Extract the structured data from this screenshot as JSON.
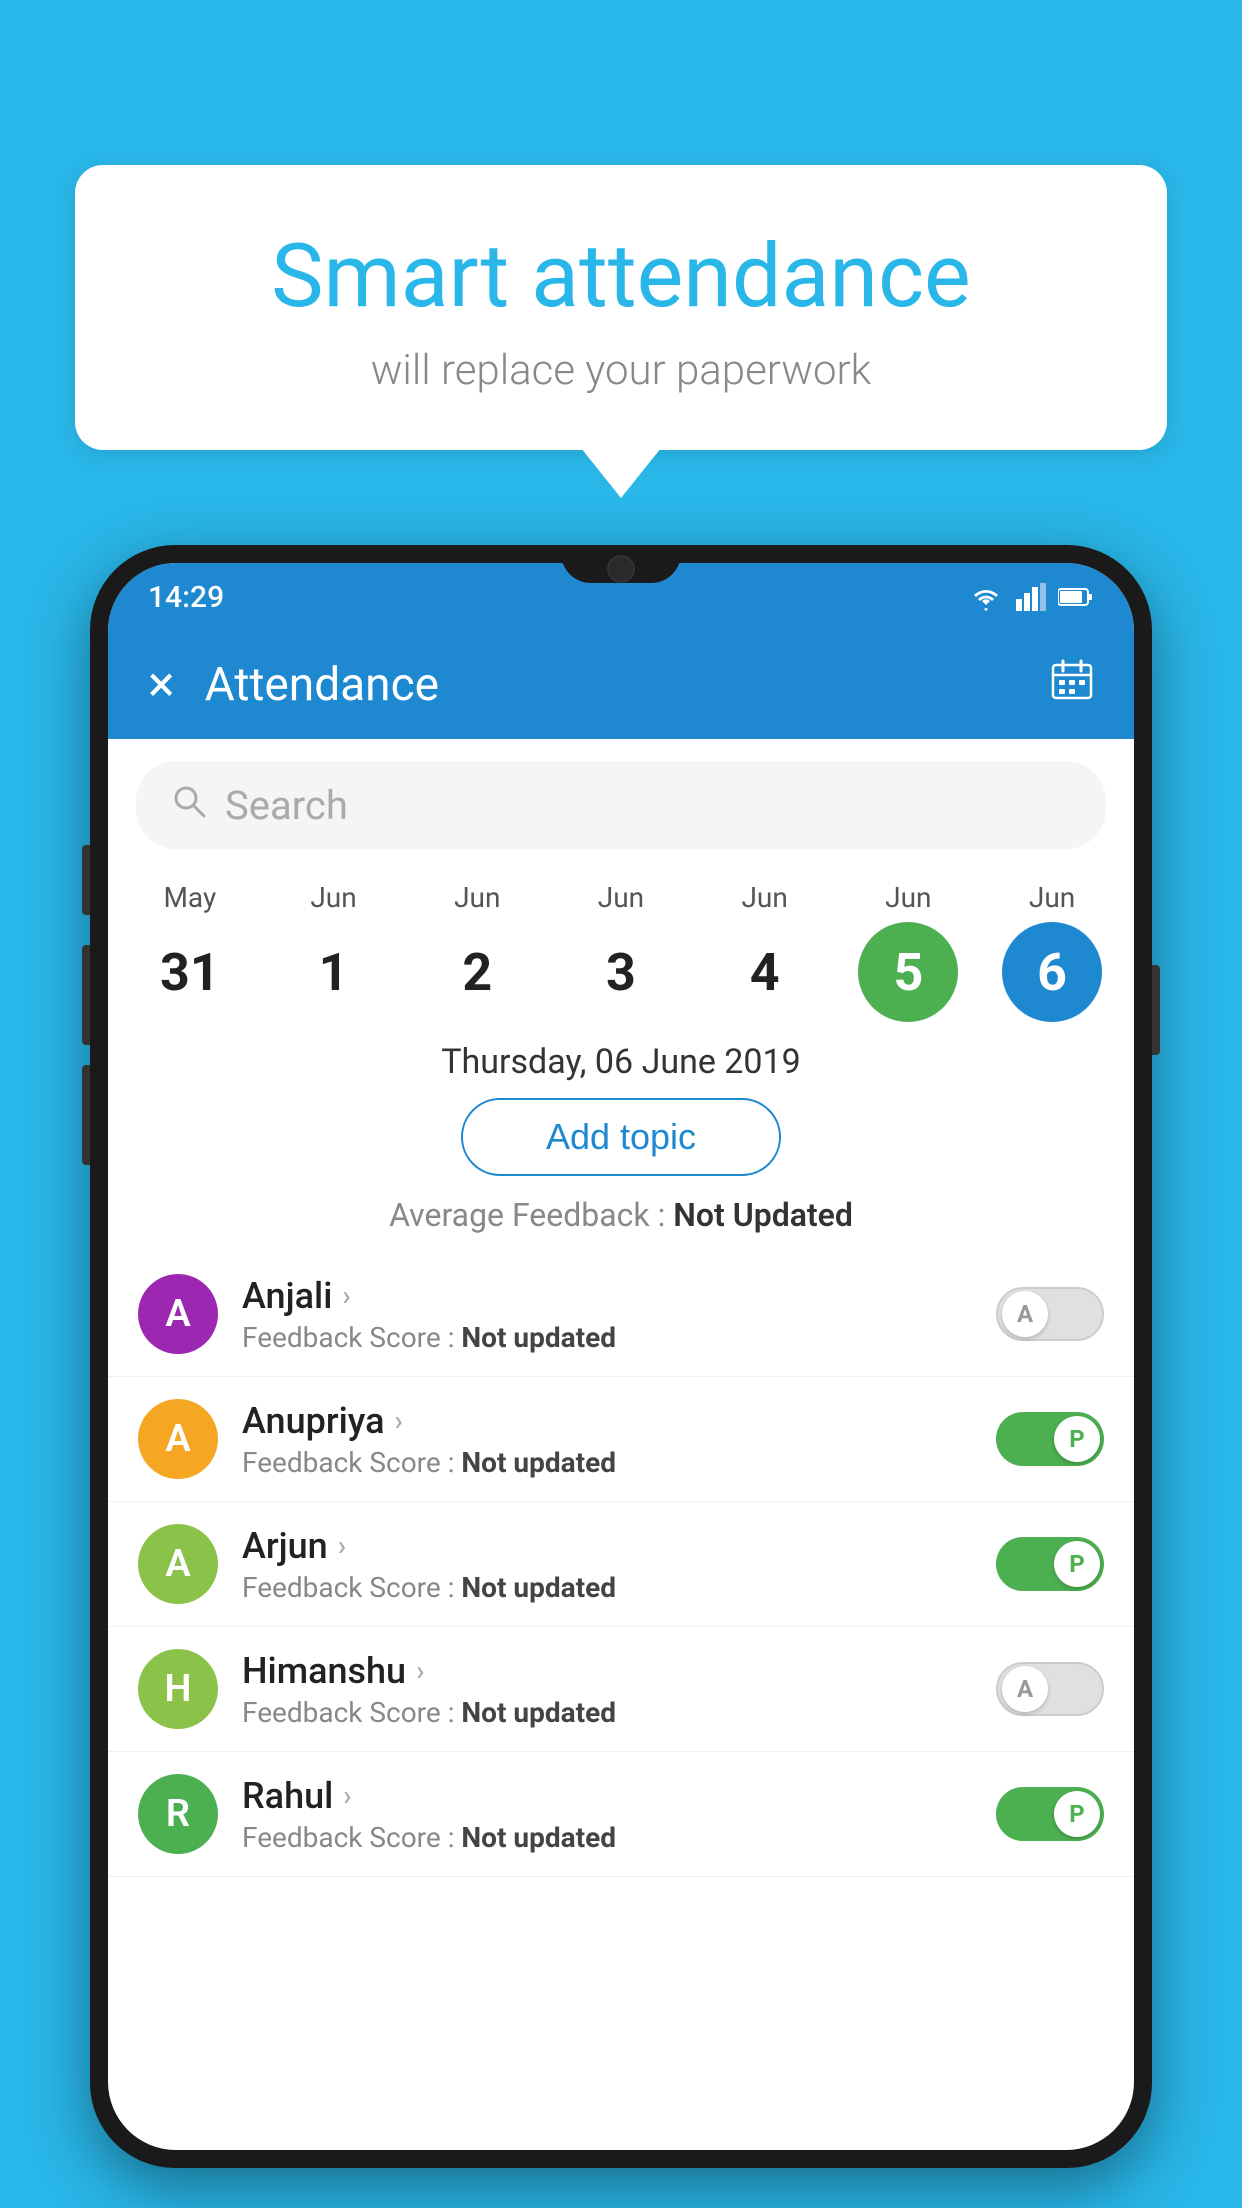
{
  "bubble": {
    "title": "Smart attendance",
    "subtitle": "will replace your paperwork"
  },
  "status_bar": {
    "time": "14:29",
    "wifi_icon": "wifi",
    "signal_icon": "signal",
    "battery_icon": "battery"
  },
  "app_bar": {
    "title": "Attendance",
    "close_label": "×",
    "calendar_label": "📅"
  },
  "search": {
    "placeholder": "Search"
  },
  "dates": [
    {
      "month": "May",
      "day": "31",
      "style": "normal"
    },
    {
      "month": "Jun",
      "day": "1",
      "style": "normal"
    },
    {
      "month": "Jun",
      "day": "2",
      "style": "normal"
    },
    {
      "month": "Jun",
      "day": "3",
      "style": "normal"
    },
    {
      "month": "Jun",
      "day": "4",
      "style": "normal"
    },
    {
      "month": "Jun",
      "day": "5",
      "style": "green"
    },
    {
      "month": "Jun",
      "day": "6",
      "style": "blue"
    }
  ],
  "selected_date": "Thursday, 06 June 2019",
  "add_topic_label": "Add topic",
  "average_feedback": {
    "label": "Average Feedback : ",
    "value": "Not Updated"
  },
  "students": [
    {
      "name": "Anjali",
      "initial": "A",
      "avatar_color": "#9c27b0",
      "feedback_label": "Feedback Score : ",
      "feedback_value": "Not updated",
      "toggle": "off",
      "toggle_label": "A"
    },
    {
      "name": "Anupriya",
      "initial": "A",
      "avatar_color": "#f5a623",
      "feedback_label": "Feedback Score : ",
      "feedback_value": "Not updated",
      "toggle": "on",
      "toggle_label": "P"
    },
    {
      "name": "Arjun",
      "initial": "A",
      "avatar_color": "#8bc34a",
      "feedback_label": "Feedback Score : ",
      "feedback_value": "Not updated",
      "toggle": "on",
      "toggle_label": "P"
    },
    {
      "name": "Himanshu",
      "initial": "H",
      "avatar_color": "#8bc34a",
      "feedback_label": "Feedback Score : ",
      "feedback_value": "Not updated",
      "toggle": "off",
      "toggle_label": "A"
    },
    {
      "name": "Rahul",
      "initial": "R",
      "avatar_color": "#4caf50",
      "feedback_label": "Feedback Score : ",
      "feedback_value": "Not updated",
      "toggle": "on",
      "toggle_label": "P"
    }
  ]
}
